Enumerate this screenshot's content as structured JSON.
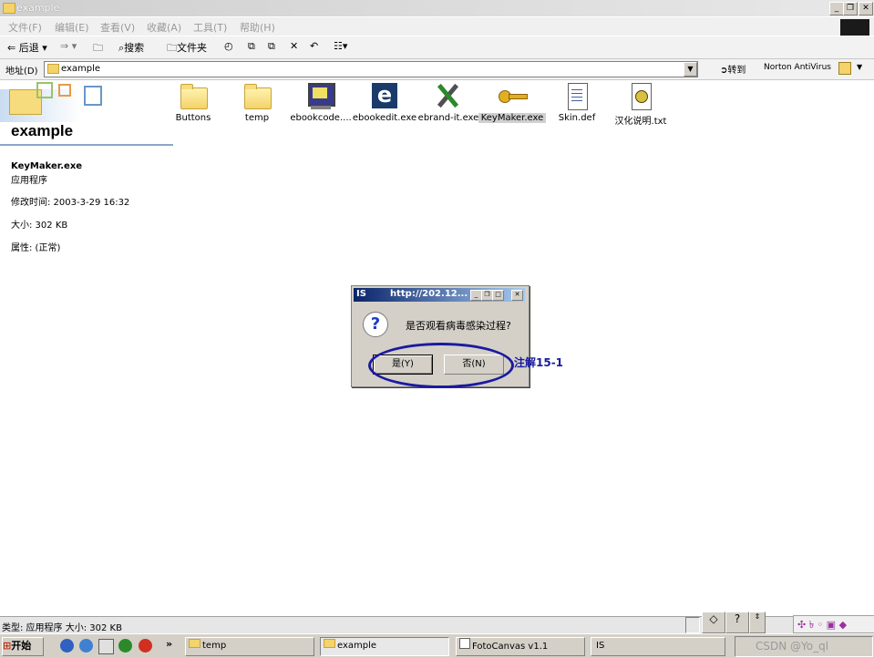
{
  "window": {
    "title": "example"
  },
  "menu": [
    "文件(F)",
    "编辑(E)",
    "查看(V)",
    "收藏(A)",
    "工具(T)",
    "帮助(H)"
  ],
  "toolbar": {
    "back": "后退",
    "search": "搜索",
    "folders": "文件夹"
  },
  "address": {
    "label": "地址(D)",
    "value": "example",
    "go": "转到",
    "norton": "Norton AntiVirus"
  },
  "left_panel": {
    "folder_title": "example",
    "selected_name": "KeyMaker.exe",
    "selected_type": "应用程序",
    "modified": "修改时间: 2003-3-29 16:32",
    "size": "大小: 302 KB",
    "attributes": "属性: (正常)"
  },
  "files": [
    {
      "name": "Buttons",
      "icon": "folder-icon"
    },
    {
      "name": "temp",
      "icon": "folder-icon"
    },
    {
      "name": "ebookcode....",
      "icon": "monitor-icon"
    },
    {
      "name": "ebookedit.exe",
      "icon": "ebook-e-icon"
    },
    {
      "name": "ebrand-it.exe",
      "icon": "tools-icon"
    },
    {
      "name": "KeyMaker.exe",
      "icon": "key-icon"
    },
    {
      "name": "Skin.def",
      "icon": "document-icon"
    },
    {
      "name": "汉化说明.txt",
      "icon": "text-file-icon"
    }
  ],
  "dialog": {
    "title_left": "IS",
    "title_right": "http://202.12...",
    "message": "是否观看病毒感染过程?",
    "yes": "是(Y)",
    "no": "否(N)",
    "annotation": "注解15-1"
  },
  "statusbar": {
    "text": "类型: 应用程序 大小: 302 KB"
  },
  "taskbar": {
    "start": "开始",
    "tasks": [
      "temp",
      "example",
      "FotoCanvas v1.1",
      "IS"
    ],
    "watermark": "CSDN @Yo_ql"
  },
  "colors": {
    "dialog_title": "#0a246a",
    "annotation": "#1a1aa0"
  }
}
